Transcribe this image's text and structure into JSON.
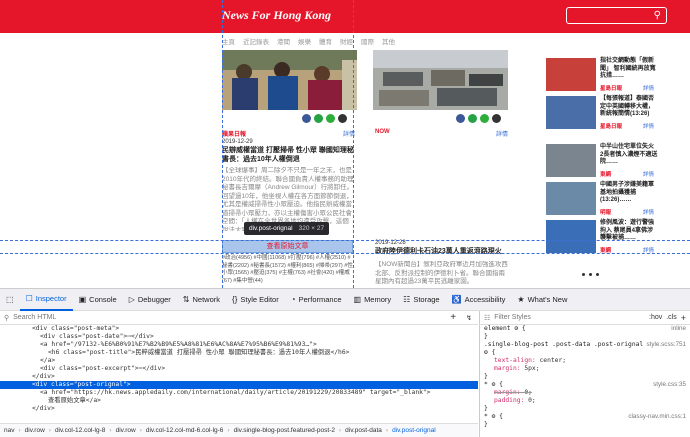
{
  "site": {
    "title": "News For Hong Kong",
    "nav": [
      "主頁",
      "近記錄表",
      "港聞",
      "娛樂",
      "體育",
      "財經",
      "國際",
      "其他"
    ]
  },
  "articles": {
    "left": {
      "source": "蘋果日報",
      "more": "詳情",
      "date": "2019-12-29",
      "headline": "民辦威權當道 打壓掃帚 性小眾 聯國知理秘書長：過去10年人權倒退",
      "excerpt": "【全球爆事】周二除夕不只是一年之末，也是2010年代的終結。聯合國負責人權事務的助理秘書長吉爾摩（Andrew Gilmour）行將卸任。回望過10年，他坐視人權在各方面節節倒退，尤其是權威掃帚性小眾壓迫。他指民辦威權當道掃帚小眾壓力，亦以主權傷害小眾公民社會空間：「人權在全世界各地均遭受攻擊，這個說法大致正確。」"
    },
    "center": {
      "source": "NOW",
      "more": "詳情",
      "date": "2019-12-28",
      "headline": "政府陸伊德利卡石油23萬人重返滾路現火",
      "excerpt": "【NOW新聞台】敘利亞政府軍近月加強進攻西北部、反對派控制的伊德利卜省。聯合國指兩星期內有超過23萬平民逃離家園。"
    },
    "tags": "#政治(4956) #中國(11068) #打壓(796) #人權(2510) #秘書(2202) #秘書長(1572) #權利(865) #掃帚(297) #性小眾(1565) #壓迫(375) #主權(763) #社會(420) #權威(67) #集中營(44)"
  },
  "inspector_highlight": {
    "tooltip_tag": "div.post-orignal",
    "tooltip_dims": "320 × 27",
    "link_text": "查看原始文章"
  },
  "sidebar": [
    {
      "title": "指社交網動態「假新聞」 智利國統再放寬抗措……",
      "source": "星島日報",
      "more": "詳情"
    },
    {
      "title": "【每張報道】泰國否定中英國轉移大權，新統報簡情(13:26)",
      "source": "星島日報",
      "more": "詳情"
    },
    {
      "title": "中半山住宅單位失火 2長者慎入濃煙不適送院……",
      "source": "東網",
      "more": "詳情"
    },
    {
      "title": "中國男子涉嫌美籍軍基地拍攝獲捕 (13:26)……",
      "source": "明報",
      "more": "詳情"
    },
    {
      "title": "修例風波：遊行警強拘入 蔡尾員4拿佛涉襲擊被捕……",
      "source": "東網",
      "more": "詳情"
    }
  ],
  "devtools": {
    "tabs": [
      "Inspector",
      "Console",
      "Debugger",
      "Network",
      "Style Editor",
      "Performance",
      "Memory",
      "Storage",
      "Accessibility",
      "What's New"
    ],
    "search_placeholder": "Search HTML",
    "filter_placeholder": "Filter Styles",
    "hov": ":hov",
    "cls": ".cls",
    "tree": [
      {
        "indent": 4,
        "text": "<div class=\"post-meta\">"
      },
      {
        "indent": 5,
        "text": "<div class=\"post-date\">⋯</div>"
      },
      {
        "indent": 5,
        "text": "<a href=\"/97132-%E6%B0%91%E7%B2%B9%E5%A8%81%E6%AC%8A%E7%95%B6%E9%81%93…\">"
      },
      {
        "indent": 6,
        "text": "<h6 class=\"post-title\">民粹威權當道 打壓掃帚 性小眾 聯國知理秘書長：過去10年人權倒退</h6>"
      },
      {
        "indent": 5,
        "text": "</a>"
      },
      {
        "indent": 5,
        "text": "<div class=\"post-excerpt\">⋯</div>"
      },
      {
        "indent": 4,
        "text": "</div>"
      },
      {
        "indent": 4,
        "text": "<div class=\"post-orignal\">",
        "selected": true
      },
      {
        "indent": 5,
        "text": "<a href=\"https://hk.news.appledaily.com/international/daily/article/20191229/20833489\" target=\"_blank\">"
      },
      {
        "indent": 6,
        "text": "查看原始文章</a>"
      },
      {
        "indent": 4,
        "text": "</div>"
      }
    ],
    "rules": [
      {
        "selector": "element ⚙ {",
        "source": "inline",
        "props": []
      },
      {
        "selector": ".single-blog-post .post-data .post-orignal ⚙ {",
        "source": "style.scss:751",
        "props": [
          [
            "text-align",
            "center;"
          ],
          [
            "margin",
            "5px;"
          ]
        ]
      },
      {
        "selector": "* ⚙ {",
        "source": "style.css:35",
        "props": [
          [
            "margin",
            "0;"
          ],
          [
            "padding",
            "0;"
          ]
        ],
        "strike": [
          0
        ]
      },
      {
        "selector": "* ⚙ {",
        "source": "classy-nav.min.css:1",
        "props": []
      }
    ],
    "breadcrumbs": [
      "nav",
      "div.row",
      "div.col-12.col-lg-8",
      "div.row",
      "div.col-12.col-md-6.col-lg-6",
      "div.single-blog-post.featured-post-2",
      "div.post-data",
      "div.post-orignal"
    ]
  },
  "colors": {
    "brand": "#e5162a",
    "select": "#0060df"
  }
}
